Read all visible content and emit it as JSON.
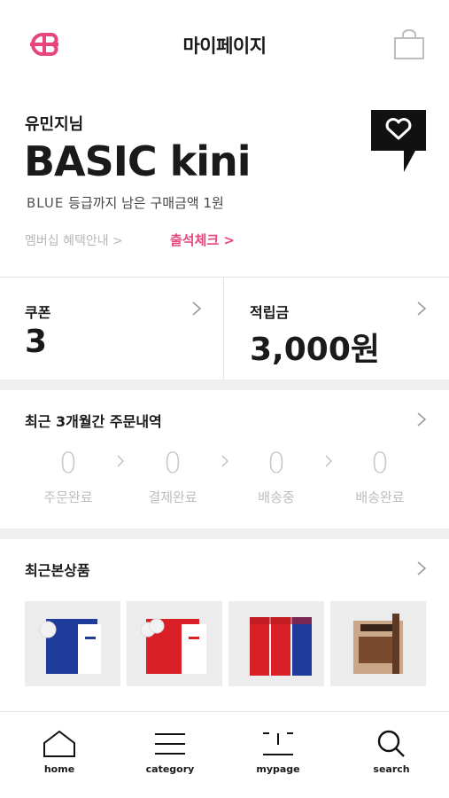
{
  "header": {
    "title": "마이페이지",
    "brand_color": "#e8457f"
  },
  "profile": {
    "user_name": "유민지님",
    "grade": "BASIC kini",
    "next_grade": "BLUE",
    "grade_info_rest": "등급까지 남은 구매금액 1원",
    "membership_link": "멤버십 혜택안내 >",
    "checkin_link": "출석체크 >"
  },
  "stats": {
    "coupon_label": "쿠폰",
    "coupon_value": "3",
    "points_label": "적립금",
    "points_value": "3,000원"
  },
  "orders": {
    "title": "최근 3개월간 주문내역",
    "steps": [
      {
        "count": "0",
        "label": "주문완료"
      },
      {
        "count": "0",
        "label": "결제완료"
      },
      {
        "count": "0",
        "label": "배송중"
      },
      {
        "count": "0",
        "label": "배송완료"
      }
    ]
  },
  "recent": {
    "title": "최근본상품",
    "products": [
      {
        "icon": "product-blue-box"
      },
      {
        "icon": "product-red-box"
      },
      {
        "icon": "product-red-blue-pouches"
      },
      {
        "icon": "product-brown-box"
      }
    ]
  },
  "nav": {
    "items": [
      {
        "label": "home",
        "icon": "home-icon"
      },
      {
        "label": "category",
        "icon": "menu-icon"
      },
      {
        "label": "mypage",
        "icon": "face-icon"
      },
      {
        "label": "search",
        "icon": "search-icon"
      }
    ]
  }
}
